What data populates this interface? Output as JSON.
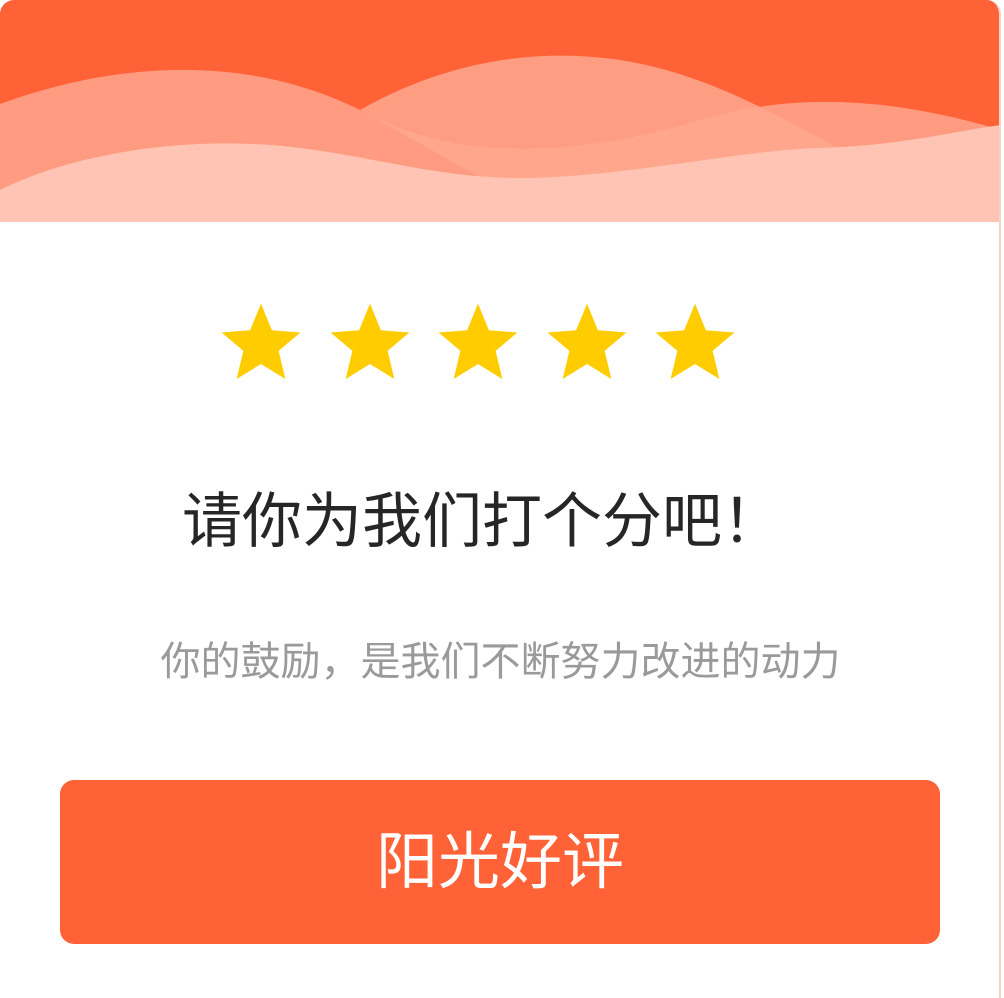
{
  "colors": {
    "header_base": "#ff6236",
    "wave_mid": "#ff9e85",
    "wave_light": "#ffc4b4",
    "star": "#ffcc00",
    "button": "#ff6236",
    "title_text": "#262626",
    "subtitle_text": "#9a9a9a"
  },
  "rating": {
    "value": 5,
    "max": 5,
    "star_icon": "star-icon"
  },
  "dialog": {
    "title": "请你为我们打个分吧！",
    "subtitle": "你的鼓励，是我们不断努力改进的动力",
    "button_label": "阳光好评"
  }
}
